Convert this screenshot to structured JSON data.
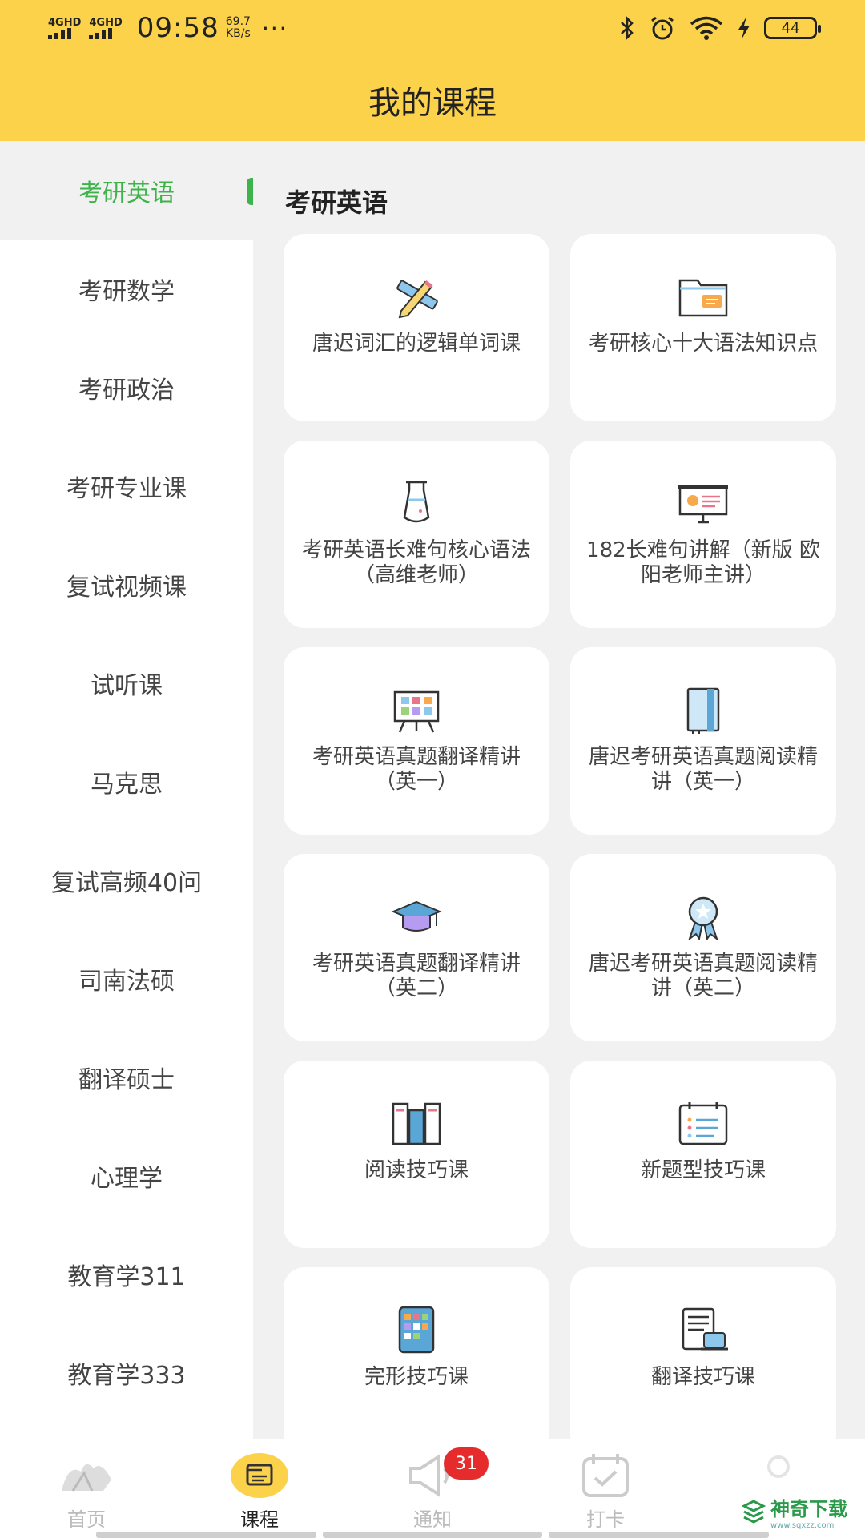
{
  "status_bar": {
    "signal1": "4GHD",
    "signal2": "4GHD",
    "time": "09:58",
    "speed_value": "69.7",
    "speed_unit": "KB/s",
    "more": "···",
    "battery": "44",
    "icons": [
      "bluetooth-icon",
      "alarm-icon",
      "wifi-icon",
      "charging-icon"
    ]
  },
  "header": {
    "title": "我的课程"
  },
  "sidebar": {
    "items": [
      {
        "label": "考研英语",
        "active": true
      },
      {
        "label": "考研数学"
      },
      {
        "label": "考研政治"
      },
      {
        "label": "考研专业课"
      },
      {
        "label": "复试视频课"
      },
      {
        "label": "试听课"
      },
      {
        "label": "马克思"
      },
      {
        "label": "复试高频40问"
      },
      {
        "label": "司南法硕"
      },
      {
        "label": "翻译硕士"
      },
      {
        "label": "心理学"
      },
      {
        "label": "教育学311"
      },
      {
        "label": "教育学333"
      }
    ]
  },
  "content": {
    "section_title": "考研英语",
    "courses": [
      {
        "title": "唐迟词汇的逻辑单词课",
        "icon": "pencil-ruler-icon"
      },
      {
        "title": "考研核心十大语法知识点",
        "icon": "folder-icon"
      },
      {
        "title": "考研英语长难句核心语法（高维老师）",
        "icon": "beaker-icon"
      },
      {
        "title": "182长难句讲解（新版 欧阳老师主讲）",
        "icon": "presentation-board-icon"
      },
      {
        "title": "考研英语真题翻译精讲（英一）",
        "icon": "easel-icon"
      },
      {
        "title": "唐迟考研英语真题阅读精讲（英一）",
        "icon": "notebook-icon"
      },
      {
        "title": "考研英语真题翻译精讲（英二）",
        "icon": "graduation-cap-icon"
      },
      {
        "title": "唐迟考研英语真题阅读精讲（英二）",
        "icon": "award-badge-icon"
      },
      {
        "title": "阅读技巧课",
        "icon": "books-icon"
      },
      {
        "title": "新题型技巧课",
        "icon": "calendar-list-icon"
      },
      {
        "title": "完形技巧课",
        "icon": "tablet-icon"
      },
      {
        "title": "翻译技巧课",
        "icon": "document-laptop-icon"
      }
    ]
  },
  "tabbar": {
    "tabs": [
      {
        "label": "首页",
        "icon": "home-logo-icon"
      },
      {
        "label": "课程",
        "icon": "course-icon",
        "active": true
      },
      {
        "label": "通知",
        "icon": "megaphone-icon",
        "badge": "31"
      },
      {
        "label": "打卡",
        "icon": "checkin-calendar-icon"
      },
      {
        "label": "",
        "icon": "profile-icon"
      }
    ]
  },
  "watermark": {
    "text": "神奇下载",
    "sub": "www.sqxzz.com"
  },
  "colors": {
    "header": "#fdd24b",
    "accent": "#3db34a",
    "badge": "#e52b2b"
  }
}
